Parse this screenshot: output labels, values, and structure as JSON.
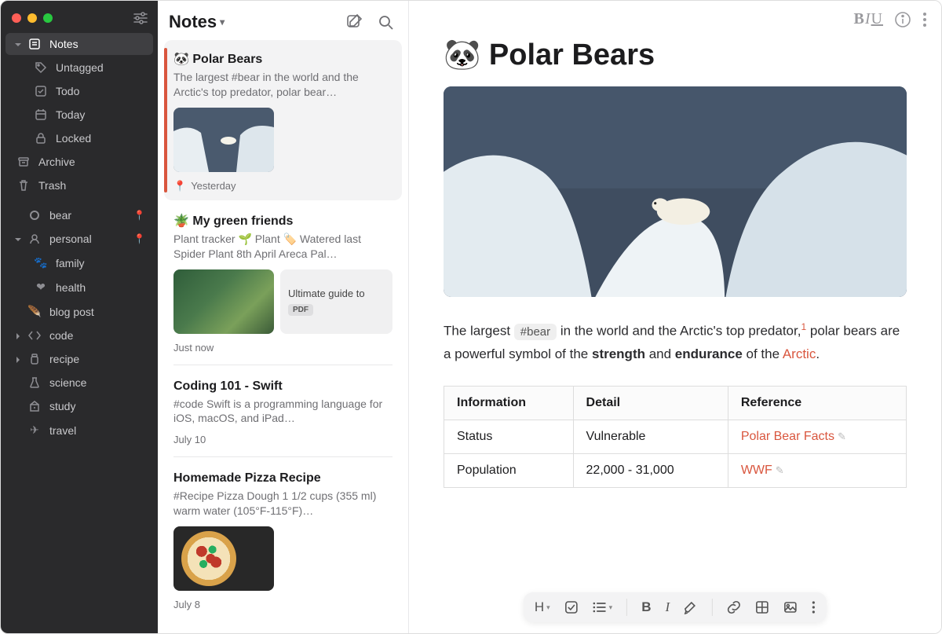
{
  "sidebar": {
    "top": [
      {
        "label": "Notes",
        "icon": "notes"
      },
      {
        "label": "Untagged",
        "icon": "tag"
      },
      {
        "label": "Todo",
        "icon": "checkbox"
      },
      {
        "label": "Today",
        "icon": "calendar"
      },
      {
        "label": "Locked",
        "icon": "lock"
      }
    ],
    "archive": "Archive",
    "trash": "Trash",
    "tags": [
      {
        "label": "bear",
        "icon": "circle",
        "pinned": true
      },
      {
        "label": "personal",
        "icon": "head",
        "pinned": true,
        "expandable": true,
        "children": [
          {
            "label": "family",
            "icon": "paw"
          },
          {
            "label": "health",
            "icon": "heart"
          }
        ]
      },
      {
        "label": "blog post",
        "icon": "feather"
      },
      {
        "label": "code",
        "icon": "code",
        "expandable": true
      },
      {
        "label": "recipe",
        "icon": "jar",
        "expandable": true
      },
      {
        "label": "science",
        "icon": "flask"
      },
      {
        "label": "study",
        "icon": "building"
      },
      {
        "label": "travel",
        "icon": "plane"
      }
    ]
  },
  "list": {
    "title": "Notes",
    "items": [
      {
        "emoji": "🐼",
        "title": "Polar Bears",
        "preview": "The largest #bear in the world and the Arctic's top predator, polar bear…",
        "date": "Yesterday",
        "pinned": true,
        "thumb": "glacier",
        "selected": true
      },
      {
        "emoji": "🪴",
        "title": "My green friends",
        "preview": "Plant tracker 🌱 Plant 🏷️ Watered last Spider Plant 8th April Areca Pal…",
        "date": "Just now",
        "thumb": "plants",
        "attach": {
          "title": "Ultimate guide to",
          "badge": "PDF"
        }
      },
      {
        "title": "Coding 101 - Swift",
        "preview": "#code Swift is a programming language for iOS, macOS, and iPad…",
        "date": "July 10"
      },
      {
        "title": "Homemade Pizza Recipe",
        "preview": "#Recipe Pizza Dough 1 1/2 cups (355 ml) warm water (105°F-115°F)…",
        "date": "July 8",
        "thumb": "pizza"
      }
    ]
  },
  "editor": {
    "emoji": "🐼",
    "title": "Polar Bears",
    "para_pre": "The largest ",
    "tag": "#bear",
    "para_mid1": " in the world and the Arctic's top predator,",
    "sup": "1",
    "para_mid2": " polar bears are a powerful symbol of the ",
    "strong1": "strength",
    "and": " and ",
    "strong2": "endurance",
    "para_mid3": " of the ",
    "link_arctic": "Arctic",
    "period": ".",
    "table": {
      "headers": [
        "Information",
        "Detail",
        "Reference"
      ],
      "rows": [
        {
          "info": "Status",
          "detail": "Vulnerable",
          "ref": "Polar Bear Facts"
        },
        {
          "info": "Population",
          "detail": "22,000 - 31,000",
          "ref": "WWF"
        }
      ]
    },
    "toolbar": {
      "h": "H",
      "b": "B",
      "i": "I"
    }
  }
}
